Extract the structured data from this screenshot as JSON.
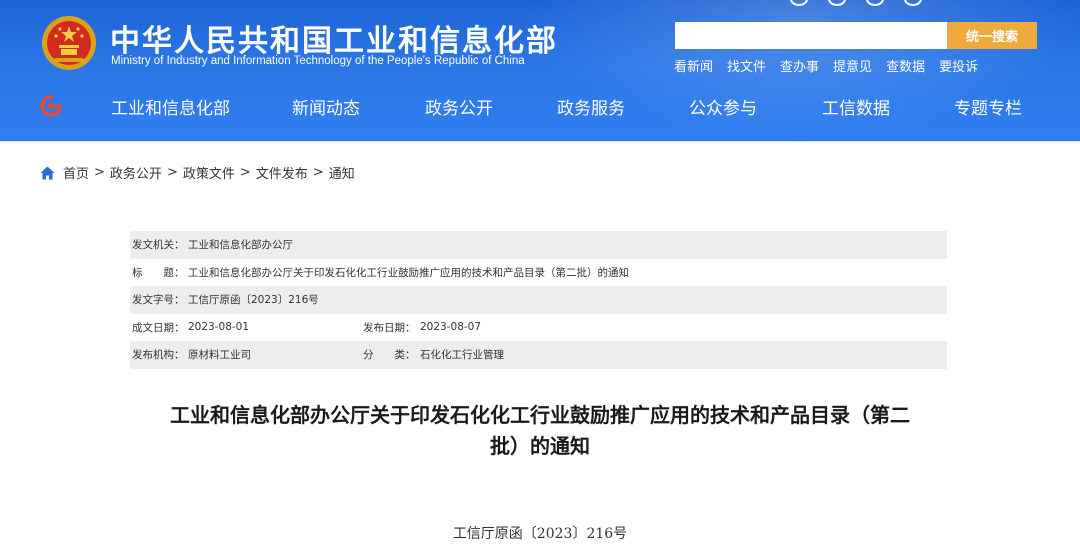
{
  "header": {
    "title": "中华人民共和国工业和信息化部",
    "subtitle": "Ministry of Industry and Information Technology of the People's Republic of China",
    "search": {
      "placeholder": "",
      "button_label": "统一搜索"
    },
    "quick_links": [
      "看新闻",
      "找文件",
      "查办事",
      "提意见",
      "查数据",
      "要投诉"
    ],
    "top_icons": [
      "circle-icon",
      "circle-icon",
      "circle-icon",
      "circle-icon"
    ]
  },
  "nav": {
    "items": [
      "工业和信息化部",
      "新闻动态",
      "政务公开",
      "政务服务",
      "公众参与",
      "工信数据",
      "专题专栏"
    ]
  },
  "breadcrumb": {
    "items": [
      "首页",
      "政务公开",
      "政策文件",
      "文件发布",
      "通知"
    ],
    "separator": ">"
  },
  "meta": {
    "issuer_label": "发文机关：",
    "issuer": "工业和信息化部办公厅",
    "title_label": "标　　题：",
    "title": "工业和信息化部办公厅关于印发石化化工行业鼓励推广应用的技术和产品目录（第二批）的通知",
    "doc_no_label": "发文字号：",
    "doc_no": "工信厅原函〔2023〕216号",
    "created_label": "成文日期：",
    "created": "2023-08-01",
    "published_label": "发布日期：",
    "published": "2023-08-07",
    "org_label": "发布机构：",
    "org": "原材料工业司",
    "category_label": "分　　类：",
    "category": "石化化工行业管理"
  },
  "article": {
    "title_line1": "工业和信息化部办公厅关于印发石化化工行业鼓励推广应用的技术和产品目录（第二",
    "title_line2": "批）的通知",
    "doc_number": "工信厅原函〔2023〕216号"
  },
  "colors": {
    "header_blue": "#2b76e6",
    "search_button": "#f0a93d",
    "meta_shade": "#ededed"
  }
}
